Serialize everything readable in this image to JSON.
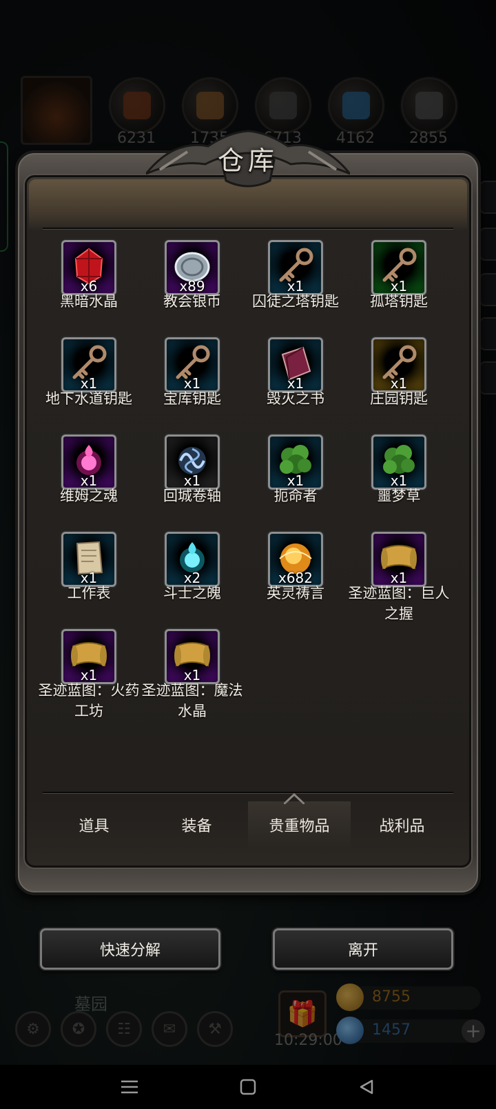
{
  "app": {
    "title": "仓库"
  },
  "resources": [
    {
      "name": "meat-icon",
      "count": "6231",
      "color": "#7a3a1a"
    },
    {
      "name": "wood-icon",
      "count": "1735",
      "color": "#8a5a2a"
    },
    {
      "name": "iron-icon",
      "count": "6713",
      "color": "#4a4a4a"
    },
    {
      "name": "crystal-icon",
      "count": "4162",
      "color": "#2a6a9a"
    },
    {
      "name": "stone-icon",
      "count": "2855",
      "color": "#555555"
    }
  ],
  "items": [
    {
      "name": "黑暗水晶",
      "qty": "x6",
      "rarity": "purple",
      "icon": "red-crystal-icon"
    },
    {
      "name": "教会银币",
      "qty": "x89",
      "rarity": "purple",
      "icon": "silver-coin-icon"
    },
    {
      "name": "囚徒之塔钥匙",
      "qty": "x1",
      "rarity": "blue",
      "icon": "key-icon"
    },
    {
      "name": "孤塔钥匙",
      "qty": "x1",
      "rarity": "green",
      "icon": "key-icon"
    },
    {
      "name": "地下水道钥匙",
      "qty": "x1",
      "rarity": "blue",
      "icon": "key-icon"
    },
    {
      "name": "宝库钥匙",
      "qty": "x1",
      "rarity": "blue",
      "icon": "key-icon"
    },
    {
      "name": "毁灭之书",
      "qty": "x1",
      "rarity": "blue",
      "icon": "book-icon"
    },
    {
      "name": "庄园钥匙",
      "qty": "x1",
      "rarity": "gold",
      "icon": "key-icon"
    },
    {
      "name": "维姆之魂",
      "qty": "x1",
      "rarity": "purple",
      "icon": "pink-soul-icon"
    },
    {
      "name": "回城卷轴",
      "qty": "x1",
      "rarity": "gray",
      "icon": "portal-scroll-icon"
    },
    {
      "name": "扼命者",
      "qty": "x1",
      "rarity": "blue",
      "icon": "herb-icon"
    },
    {
      "name": "噩梦草",
      "qty": "x1",
      "rarity": "blue",
      "icon": "herb-icon"
    },
    {
      "name": "工作表",
      "qty": "x1",
      "rarity": "blue",
      "icon": "paper-icon"
    },
    {
      "name": "斗士之魄",
      "qty": "x2",
      "rarity": "blue",
      "icon": "cyan-soul-icon"
    },
    {
      "name": "英灵祷言",
      "qty": "x682",
      "rarity": "blue",
      "icon": "golden-orb-icon"
    },
    {
      "name": "圣迹蓝图：巨人之握",
      "qty": "x1",
      "rarity": "purple",
      "icon": "blueprint-scroll-icon"
    },
    {
      "name": "圣迹蓝图：火药工坊",
      "qty": "x1",
      "rarity": "purple",
      "icon": "blueprint-scroll-icon"
    },
    {
      "name": "圣迹蓝图：魔法水晶",
      "qty": "x1",
      "rarity": "purple",
      "icon": "blueprint-scroll-icon"
    }
  ],
  "tabs": [
    {
      "label": "道具",
      "active": false
    },
    {
      "label": "装备",
      "active": false
    },
    {
      "label": "贵重物品",
      "active": true
    },
    {
      "label": "战利品",
      "active": false
    }
  ],
  "buttons": {
    "decompose": "快速分解",
    "leave": "离开"
  },
  "hud": {
    "location": "墓园",
    "clock": "10:29:00",
    "gold": "8755",
    "gems": "1457",
    "gold_color": "#c7922a",
    "gem_color": "#3a78b8"
  },
  "rarity_colors": {
    "purple": "#6a0f9c",
    "blue": "#0e4f6d",
    "green": "#0e7a1d",
    "gold": "#8a6a10",
    "gray": "#3a3a3a"
  }
}
